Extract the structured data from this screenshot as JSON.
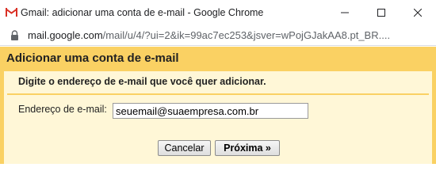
{
  "window": {
    "title": "Gmail: adicionar uma conta de e-mail - Google Chrome",
    "icon": "gmail-icon",
    "controls": [
      "minimize-icon",
      "maximize-icon",
      "close-icon"
    ]
  },
  "address_bar": {
    "url_domain": "mail.google.com",
    "url_path": "/mail/u/4/?ui=2&ik=99ac7ec253&jsver=wPojGJakAA8.pt_BR....",
    "icon": "lock-icon"
  },
  "dialog": {
    "title": "Adicionar uma conta de e-mail",
    "subtitle": "Digite o endereço de e-mail que você quer adicionar.",
    "email_label": "Endereço de e-mail:",
    "email_value": "seuemail@suaempresa.com.br",
    "cancel_label": "Cancelar",
    "next_label": "Próxima »"
  },
  "colors": {
    "page_background": "#fad163",
    "panel_background": "#fff7d7"
  }
}
